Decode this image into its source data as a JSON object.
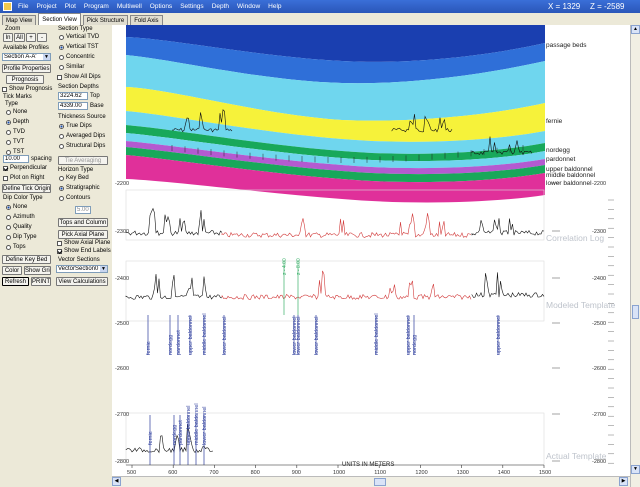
{
  "menu": {
    "items": [
      "File",
      "Project",
      "Plot",
      "Program",
      "Multiwell",
      "Options",
      "Settings",
      "Depth",
      "Window",
      "Help"
    ],
    "x_readout": "X = 1329",
    "z_readout": "Z = -2589"
  },
  "tabs": [
    "Map View",
    "Section View",
    "Pick Structure",
    "Fold Axis"
  ],
  "left": {
    "zoom_label": "Zoom",
    "zoom_buttons": [
      "In",
      "All",
      "+",
      "-"
    ],
    "profiles_label": "Available Profiles",
    "profile_value": "Section A-A'",
    "profile_properties": "Profile Properties",
    "prognosis": "Prognosis",
    "show_prognosis": "Show Prognosis",
    "tick_marks_label": "Tick Marks",
    "type_label": "Type",
    "type_options": [
      "None",
      "Depth",
      "TVD",
      "TVT",
      "TST"
    ],
    "spacing_value": "10.00",
    "spacing_label": "spacing",
    "perpendicular": "Perpendicular",
    "plot_on_right": "Plot on Right",
    "define_tick_origin": "Define Tick Origin",
    "dip_color_label": "Dip Color Type",
    "dip_options": [
      "None",
      "Azimuth",
      "Quality",
      "Dip Type",
      "Tops"
    ],
    "define_key_bed": "Define Key Bed",
    "color": "Color",
    "show_grid": "Show Grid",
    "refresh": "Refresh",
    "print": "PRINT",
    "section_type_label": "Section Type",
    "section_types": [
      "Vertical TVD",
      "Vertical TST",
      "Concentric",
      "Similar"
    ],
    "show_all_dips": "Show All Dips",
    "section_depths_label": "Section Depths",
    "top_value": "3224.62",
    "top_label": "Top",
    "base_value": "4339.00",
    "base_label": "Base",
    "thickness_label": "Thickness Source",
    "thickness_options": [
      "True Dips",
      "Averaged Dips",
      "Structural Dips"
    ],
    "tie_averaging": "Tie Averaging",
    "horizon_type_label": "Horizon Type",
    "horizon_options": [
      "Key Bed",
      "Stratigraphic",
      "Contours"
    ],
    "contour_value": "5.00",
    "tops_and_column": "Tops and Column",
    "pick_axial_plane": "Pick Axial Plane",
    "show_axial_plane": "Show Axial Plane",
    "show_end_labels": "Show End Labels",
    "vector_sections_label": "Vector Sections",
    "vector_value": "VectorSection0",
    "view_calculations": "View Calculations"
  },
  "section": {
    "horizons": [
      "passage beds",
      "fernie",
      "nordegg",
      "pardonnet",
      "upper baldonnel",
      "middle baldonnel",
      "lower baldonnel"
    ],
    "depth_ticks": [
      "-2200",
      "-2300",
      "-2400",
      "-2500",
      "-2600",
      "-2700",
      "-2800"
    ],
    "panel_titles": [
      "Correlation Log",
      "Modeled Template",
      "Actual Template"
    ],
    "x_axis_label": "UNITS IN METERS",
    "x_ticks": [
      "500",
      "600",
      "700",
      "800",
      "900",
      "1000",
      "1100",
      "1200",
      "1300",
      "1400",
      "1500"
    ],
    "modeled_markers": [
      "fernie",
      "nordegg",
      "pardonnet",
      "upper baldonnel",
      "middle baldonnel",
      "lower baldonnel",
      "lower baldonnel",
      "lower baldonnel",
      "lower baldonnel",
      "middle baldonnel",
      "upper baldonnel",
      "nordegg",
      "upper baldonnel"
    ],
    "actual_markers": [
      "fernie",
      "nordegg",
      "pardonnet",
      "upper baldonnel",
      "middle baldonnel",
      "lower baldonnel"
    ],
    "green_markers": [
      "z - 4.00",
      "z - 8.00"
    ]
  },
  "colors": {
    "passage_beds": "#1a3fb0",
    "blue_band": "#2f6fd8",
    "cyan": "#6fd6ee",
    "yellow": "#f6f23a",
    "green": "#18a85a",
    "magenta": "#e0309a",
    "log_red": "#d23c3c",
    "marker_blue": "#2c3c9c"
  }
}
